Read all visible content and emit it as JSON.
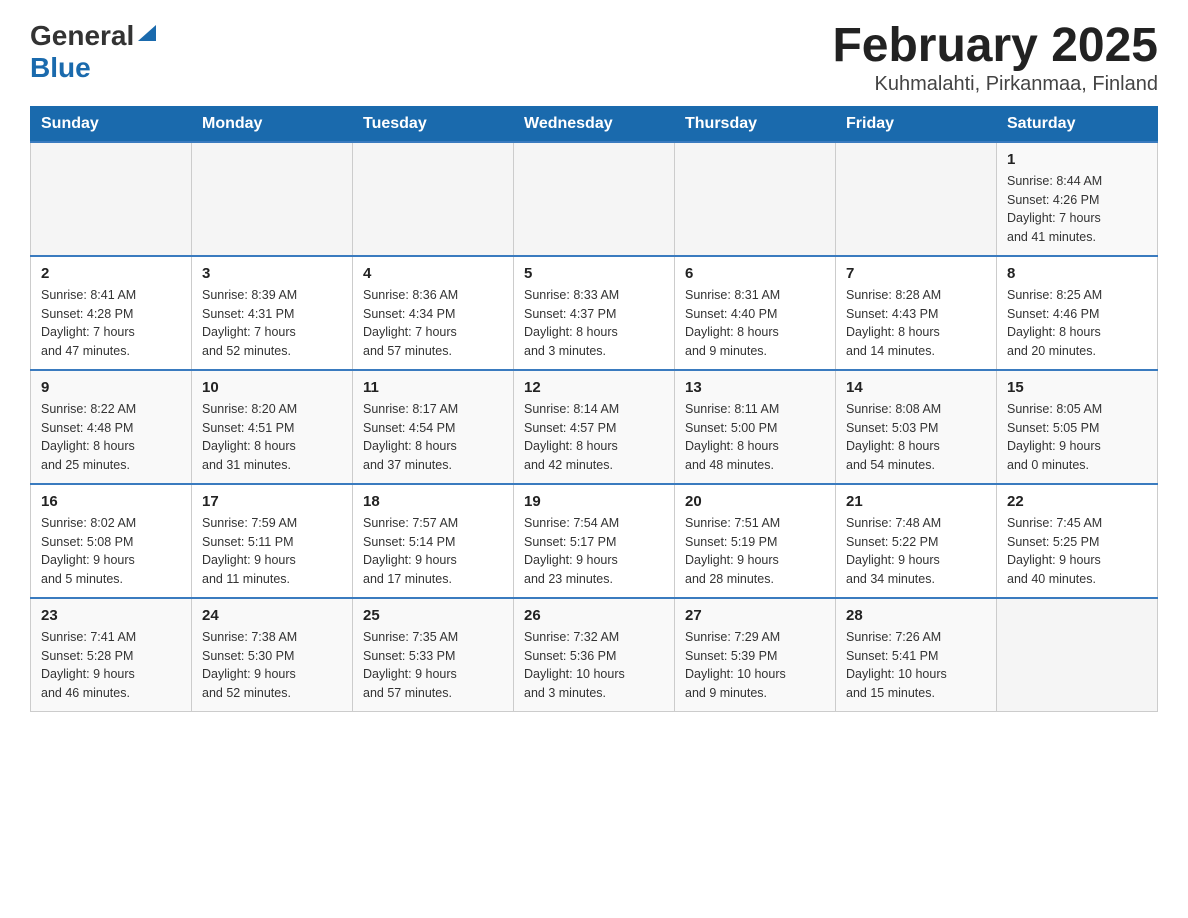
{
  "header": {
    "logo_general": "General",
    "logo_blue": "Blue",
    "title": "February 2025",
    "subtitle": "Kuhmalahti, Pirkanmaa, Finland"
  },
  "weekdays": [
    "Sunday",
    "Monday",
    "Tuesday",
    "Wednesday",
    "Thursday",
    "Friday",
    "Saturday"
  ],
  "weeks": [
    [
      {
        "day": "",
        "info": ""
      },
      {
        "day": "",
        "info": ""
      },
      {
        "day": "",
        "info": ""
      },
      {
        "day": "",
        "info": ""
      },
      {
        "day": "",
        "info": ""
      },
      {
        "day": "",
        "info": ""
      },
      {
        "day": "1",
        "info": "Sunrise: 8:44 AM\nSunset: 4:26 PM\nDaylight: 7 hours\nand 41 minutes."
      }
    ],
    [
      {
        "day": "2",
        "info": "Sunrise: 8:41 AM\nSunset: 4:28 PM\nDaylight: 7 hours\nand 47 minutes."
      },
      {
        "day": "3",
        "info": "Sunrise: 8:39 AM\nSunset: 4:31 PM\nDaylight: 7 hours\nand 52 minutes."
      },
      {
        "day": "4",
        "info": "Sunrise: 8:36 AM\nSunset: 4:34 PM\nDaylight: 7 hours\nand 57 minutes."
      },
      {
        "day": "5",
        "info": "Sunrise: 8:33 AM\nSunset: 4:37 PM\nDaylight: 8 hours\nand 3 minutes."
      },
      {
        "day": "6",
        "info": "Sunrise: 8:31 AM\nSunset: 4:40 PM\nDaylight: 8 hours\nand 9 minutes."
      },
      {
        "day": "7",
        "info": "Sunrise: 8:28 AM\nSunset: 4:43 PM\nDaylight: 8 hours\nand 14 minutes."
      },
      {
        "day": "8",
        "info": "Sunrise: 8:25 AM\nSunset: 4:46 PM\nDaylight: 8 hours\nand 20 minutes."
      }
    ],
    [
      {
        "day": "9",
        "info": "Sunrise: 8:22 AM\nSunset: 4:48 PM\nDaylight: 8 hours\nand 25 minutes."
      },
      {
        "day": "10",
        "info": "Sunrise: 8:20 AM\nSunset: 4:51 PM\nDaylight: 8 hours\nand 31 minutes."
      },
      {
        "day": "11",
        "info": "Sunrise: 8:17 AM\nSunset: 4:54 PM\nDaylight: 8 hours\nand 37 minutes."
      },
      {
        "day": "12",
        "info": "Sunrise: 8:14 AM\nSunset: 4:57 PM\nDaylight: 8 hours\nand 42 minutes."
      },
      {
        "day": "13",
        "info": "Sunrise: 8:11 AM\nSunset: 5:00 PM\nDaylight: 8 hours\nand 48 minutes."
      },
      {
        "day": "14",
        "info": "Sunrise: 8:08 AM\nSunset: 5:03 PM\nDaylight: 8 hours\nand 54 minutes."
      },
      {
        "day": "15",
        "info": "Sunrise: 8:05 AM\nSunset: 5:05 PM\nDaylight: 9 hours\nand 0 minutes."
      }
    ],
    [
      {
        "day": "16",
        "info": "Sunrise: 8:02 AM\nSunset: 5:08 PM\nDaylight: 9 hours\nand 5 minutes."
      },
      {
        "day": "17",
        "info": "Sunrise: 7:59 AM\nSunset: 5:11 PM\nDaylight: 9 hours\nand 11 minutes."
      },
      {
        "day": "18",
        "info": "Sunrise: 7:57 AM\nSunset: 5:14 PM\nDaylight: 9 hours\nand 17 minutes."
      },
      {
        "day": "19",
        "info": "Sunrise: 7:54 AM\nSunset: 5:17 PM\nDaylight: 9 hours\nand 23 minutes."
      },
      {
        "day": "20",
        "info": "Sunrise: 7:51 AM\nSunset: 5:19 PM\nDaylight: 9 hours\nand 28 minutes."
      },
      {
        "day": "21",
        "info": "Sunrise: 7:48 AM\nSunset: 5:22 PM\nDaylight: 9 hours\nand 34 minutes."
      },
      {
        "day": "22",
        "info": "Sunrise: 7:45 AM\nSunset: 5:25 PM\nDaylight: 9 hours\nand 40 minutes."
      }
    ],
    [
      {
        "day": "23",
        "info": "Sunrise: 7:41 AM\nSunset: 5:28 PM\nDaylight: 9 hours\nand 46 minutes."
      },
      {
        "day": "24",
        "info": "Sunrise: 7:38 AM\nSunset: 5:30 PM\nDaylight: 9 hours\nand 52 minutes."
      },
      {
        "day": "25",
        "info": "Sunrise: 7:35 AM\nSunset: 5:33 PM\nDaylight: 9 hours\nand 57 minutes."
      },
      {
        "day": "26",
        "info": "Sunrise: 7:32 AM\nSunset: 5:36 PM\nDaylight: 10 hours\nand 3 minutes."
      },
      {
        "day": "27",
        "info": "Sunrise: 7:29 AM\nSunset: 5:39 PM\nDaylight: 10 hours\nand 9 minutes."
      },
      {
        "day": "28",
        "info": "Sunrise: 7:26 AM\nSunset: 5:41 PM\nDaylight: 10 hours\nand 15 minutes."
      },
      {
        "day": "",
        "info": ""
      }
    ]
  ]
}
